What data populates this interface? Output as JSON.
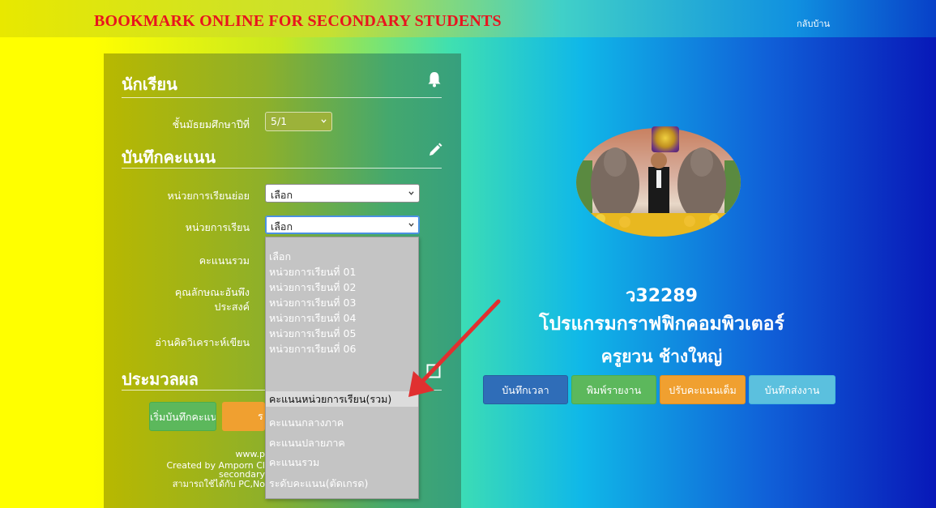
{
  "header": {
    "brand": "BOOKMARK ONLINE FOR SECONDARY STUDENTS",
    "home_link": "กลับบ้าน"
  },
  "student_section": {
    "title": "นักเรียน",
    "grade_label": "ชั้นมัธยมศึกษาปีที่",
    "grade_value": "5/1"
  },
  "score_section": {
    "title": "บันทึกคะแนน",
    "sub_unit_label": "หน่วยการเรียนย่อย",
    "sub_unit_value": "เลือก",
    "unit_label": "หน่วยการเรียน",
    "unit_value": "เลือก",
    "total_label": "คะแนนรวม",
    "trait_label_1": "คุณลักษณะอันพึง",
    "trait_label_2": "ประสงค์",
    "reading_label": "อ่านคิดวิเคราะห์เขียน"
  },
  "dropdown": {
    "options": [
      "เลือก",
      "หน่วยการเรียนที่ 01",
      "หน่วยการเรียนที่ 02",
      "หน่วยการเรียนที่ 03",
      "หน่วยการเรียนที่ 04",
      "หน่วยการเรียนที่ 05",
      "หน่วยการเรียนที่ 06",
      "คะแนนหน่วยการเรียน(รวม)",
      "คะแนนกลางภาค",
      "คะแนนปลายภาค",
      "คะแนนรวม",
      "ระดับคะแนน(ตัดเกรด)"
    ],
    "highlighted": "คะแนนหน่วยการเรียน(รวม)"
  },
  "process_section": {
    "title": "ประมวลผล",
    "start_button": "เริ่มบันทึกคะแนน",
    "report_button_partial": "ร"
  },
  "footer": {
    "line1": "www.p",
    "line2": "Created by Amporn Cl",
    "line3": "secondary",
    "line4": "สามารถใช้ได้กับ PC,No"
  },
  "course": {
    "code": "ว32289",
    "name": "โปรแกรมกราฟฟิกคอมพิวเตอร์",
    "teacher": "ครูยวน ช้างใหญ่"
  },
  "actions": {
    "time_button": "บันทึกเวลา",
    "print_button": "พิมพ์รายงาน",
    "adjust_button": "ปรับคะแนนเต็ม",
    "submit_button": "บันทึกส่งงาน"
  },
  "colors": {
    "brand_red": "#e8141e",
    "btn_blue": "#2f6db8",
    "btn_green": "#5cb85c",
    "btn_orange": "#f0a030",
    "btn_lightblue": "#5bc0de"
  }
}
